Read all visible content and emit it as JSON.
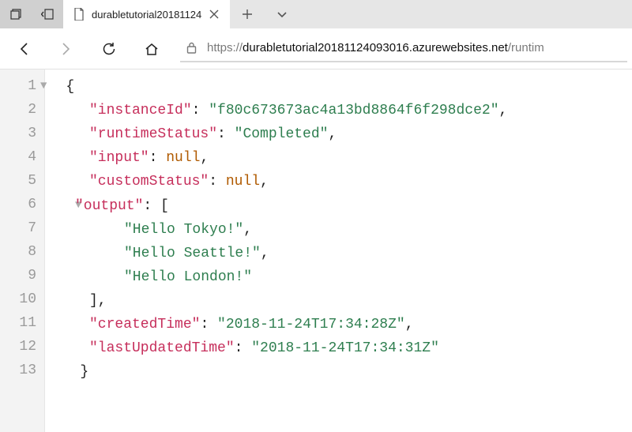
{
  "tab": {
    "title": "durabletutorial20181124"
  },
  "url": {
    "scheme": "https://",
    "host": "durabletutorial20181124093016.azurewebsites.net",
    "path": "/runtim"
  },
  "json": {
    "k_instanceId": "\"instanceId\"",
    "v_instanceId": "\"f80c673673ac4a13bd8864f6f298dce2\"",
    "k_runtime": "\"runtimeStatus\"",
    "v_runtime": "\"Completed\"",
    "k_input": "\"input\"",
    "v_input": "null",
    "k_custom": "\"customStatus\"",
    "v_custom": "null",
    "k_output": "\"output\"",
    "out0": "\"Hello Tokyo!\"",
    "out1": "\"Hello Seattle!\"",
    "out2": "\"Hello London!\"",
    "k_created": "\"createdTime\"",
    "v_created": "\"2018-11-24T17:34:28Z\"",
    "k_updated": "\"lastUpdatedTime\"",
    "v_updated": "\"2018-11-24T17:34:31Z\""
  },
  "lines": {
    "l1": "1",
    "l2": "2",
    "l3": "3",
    "l4": "4",
    "l5": "5",
    "l6": "6",
    "l7": "7",
    "l8": "8",
    "l9": "9",
    "l10": "10",
    "l11": "11",
    "l12": "12",
    "l13": "13"
  }
}
